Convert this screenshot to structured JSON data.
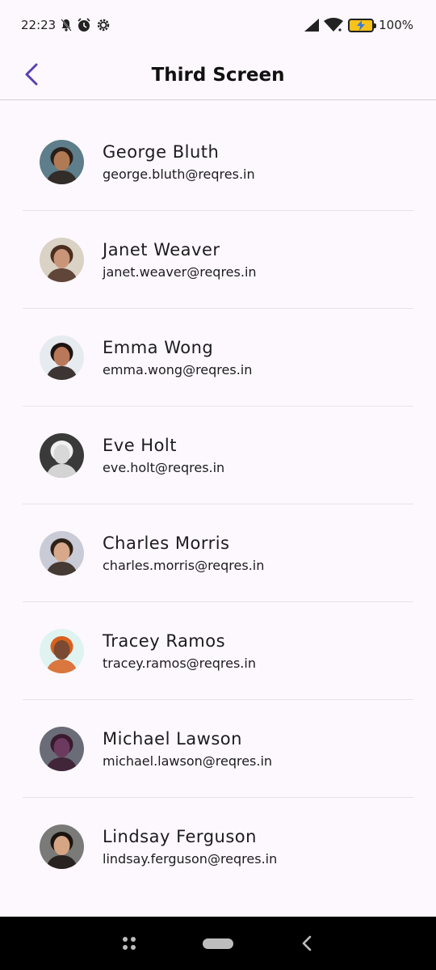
{
  "status_bar": {
    "time": "22:23",
    "battery_percent": "100%",
    "icons": [
      "notification-muted-icon",
      "alarm-icon",
      "settings-icon",
      "signal-icon",
      "wifi-icon",
      "battery-charging-icon"
    ]
  },
  "app_bar": {
    "title": "Third Screen",
    "back_icon": "chevron-left-icon",
    "accent_color": "#5b3fb0"
  },
  "users": [
    {
      "name": "George Bluth",
      "email": "george.bluth@reqres.in",
      "avatar_bg": "#5d7e8a",
      "skin": "#b07a55",
      "hair": "#2a1e18"
    },
    {
      "name": "Janet Weaver",
      "email": "janet.weaver@reqres.in",
      "avatar_bg": "#d9d2c5",
      "skin": "#c99578",
      "hair": "#4a2e1e"
    },
    {
      "name": "Emma Wong",
      "email": "emma.wong@reqres.in",
      "avatar_bg": "#e6ebf0",
      "skin": "#b9785a",
      "hair": "#1e1512"
    },
    {
      "name": "Eve Holt",
      "email": "eve.holt@reqres.in",
      "avatar_bg": "#3a3a3a",
      "skin": "#d8d8d8",
      "hair": "#f0f0f0"
    },
    {
      "name": "Charles Morris",
      "email": "charles.morris@reqres.in",
      "avatar_bg": "#c9cbd6",
      "skin": "#d7a88a",
      "hair": "#2e2218"
    },
    {
      "name": "Tracey Ramos",
      "email": "tracey.ramos@reqres.in",
      "avatar_bg": "#dff4f1",
      "skin": "#7a4a32",
      "hair": "#d9601e"
    },
    {
      "name": "Michael Lawson",
      "email": "michael.lawson@reqres.in",
      "avatar_bg": "#6a6d78",
      "skin": "#6b3a5e",
      "hair": "#3a1a2e"
    },
    {
      "name": "Lindsay Ferguson",
      "email": "lindsay.ferguson@reqres.in",
      "avatar_bg": "#7a7a78",
      "skin": "#d6a583",
      "hair": "#1a1410"
    }
  ],
  "nav_bar": {
    "recents_icon": "recents-grid-icon",
    "home_icon": "home-pill-icon",
    "back_icon": "nav-back-icon"
  }
}
